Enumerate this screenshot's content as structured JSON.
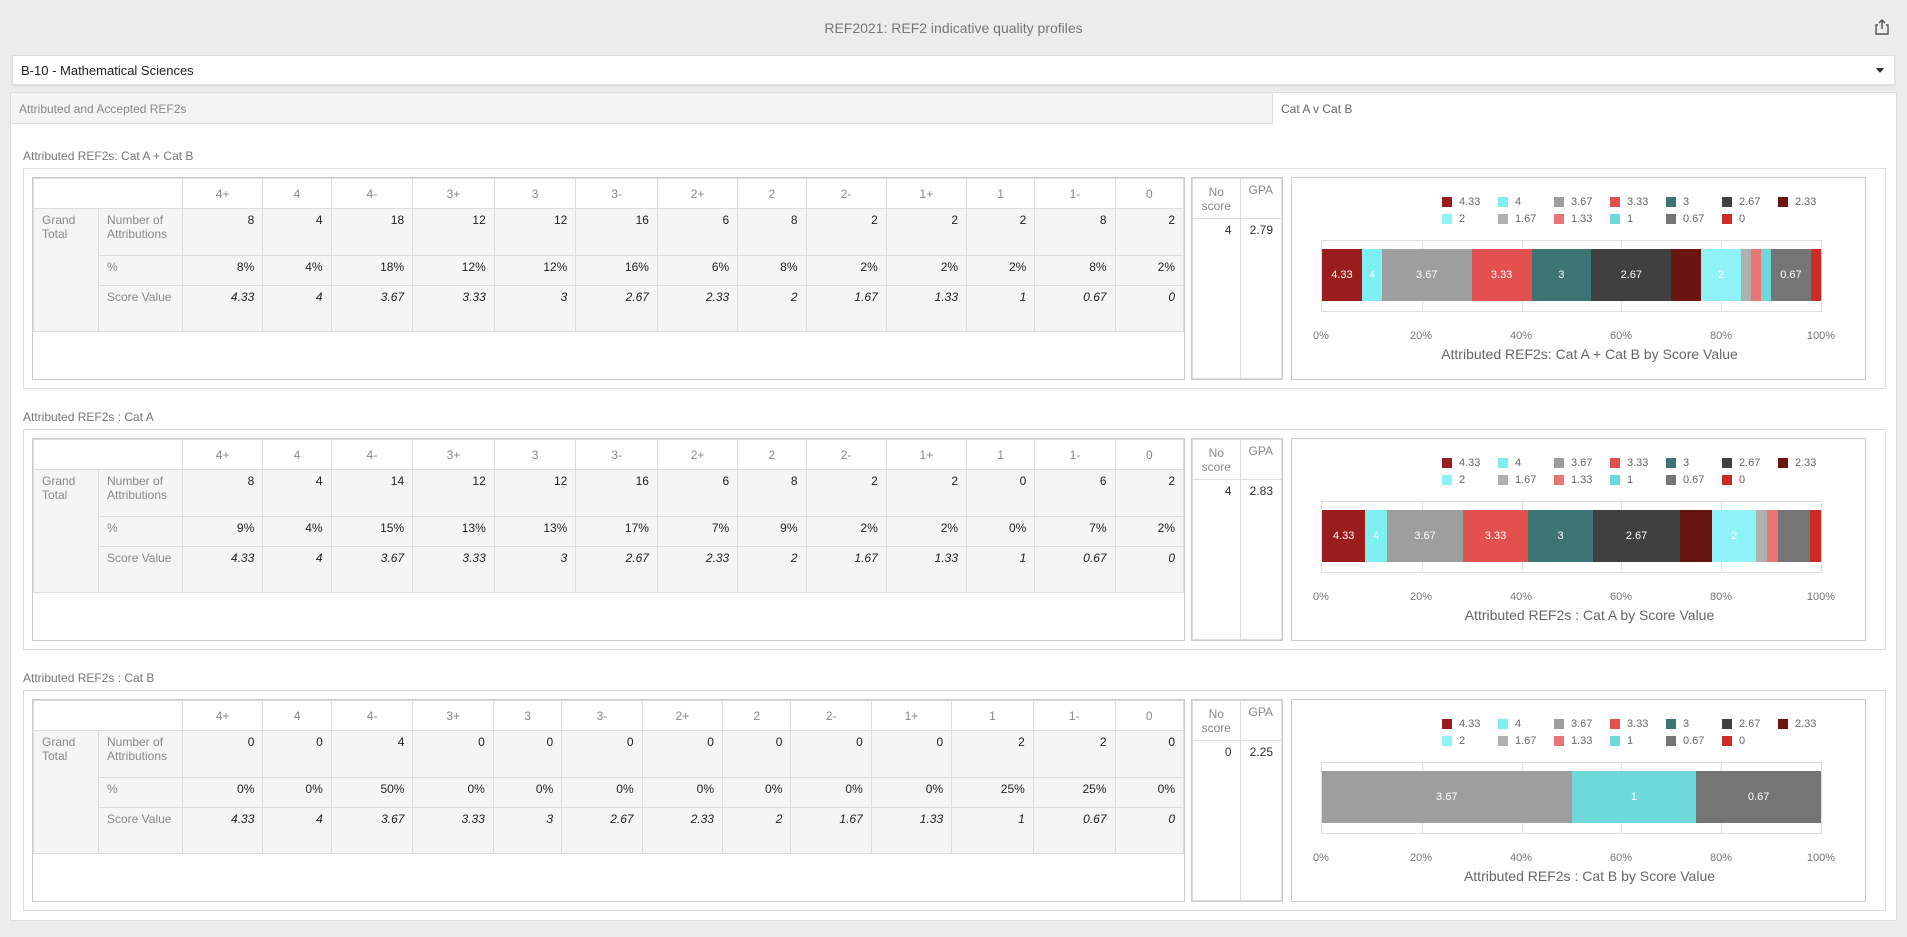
{
  "header": {
    "title": "REF2021: REF2 indicative quality profiles"
  },
  "unit_select": {
    "value": "B-10 - Mathematical Sciences"
  },
  "tabs": [
    {
      "label": "Attributed and Accepted REF2s"
    },
    {
      "label": "Cat A v Cat B"
    }
  ],
  "grades": [
    "4+",
    "4",
    "4-",
    "3+",
    "3",
    "3-",
    "2+",
    "2",
    "2-",
    "1+",
    "1",
    "1-",
    "0"
  ],
  "scores": [
    "4.33",
    "4",
    "3.67",
    "3.33",
    "3",
    "2.67",
    "2.33",
    "2",
    "1.67",
    "1.33",
    "1",
    "0.67",
    "0"
  ],
  "row_labels": {
    "group": "Grand Total",
    "count": "Number of Attributions",
    "pct": "%",
    "score": "Score Value"
  },
  "side_headers": {
    "no_score": "No score",
    "gpa": "GPA"
  },
  "colors": {
    "4.33": "#9b1c1c",
    "4": "#7ff0f2",
    "3.67": "#9e9e9e",
    "3.33": "#e2504f",
    "3": "#3d7575",
    "2.67": "#404040",
    "2.33": "#6b1510",
    "2": "#8ef2f7",
    "1.67": "#b0b0b0",
    "1.33": "#e87676",
    "1": "#6fd8da",
    "0.67": "#757575",
    "0": "#cc2b26"
  },
  "sections": [
    {
      "title": "Attributed REF2s: Cat A + Cat B",
      "counts": [
        "8",
        "4",
        "18",
        "12",
        "12",
        "16",
        "6",
        "8",
        "2",
        "2",
        "2",
        "8",
        "2"
      ],
      "percents": [
        "8%",
        "4%",
        "18%",
        "12%",
        "12%",
        "16%",
        "6%",
        "8%",
        "2%",
        "2%",
        "2%",
        "8%",
        "2%"
      ],
      "no_score": "4",
      "gpa": "2.79"
    },
    {
      "title": "Attributed REF2s : Cat A",
      "counts": [
        "8",
        "4",
        "14",
        "12",
        "12",
        "16",
        "6",
        "8",
        "2",
        "2",
        "0",
        "6",
        "2"
      ],
      "percents": [
        "9%",
        "4%",
        "15%",
        "13%",
        "13%",
        "17%",
        "7%",
        "9%",
        "2%",
        "2%",
        "0%",
        "7%",
        "2%"
      ],
      "no_score": "4",
      "gpa": "2.83"
    },
    {
      "title": "Attributed REF2s : Cat B",
      "counts": [
        "0",
        "0",
        "4",
        "0",
        "0",
        "0",
        "0",
        "0",
        "0",
        "0",
        "2",
        "2",
        "0"
      ],
      "percents": [
        "0%",
        "0%",
        "50%",
        "0%",
        "0%",
        "0%",
        "0%",
        "0%",
        "0%",
        "0%",
        "25%",
        "25%",
        "0%"
      ],
      "no_score": "0",
      "gpa": "2.25"
    }
  ],
  "chart_data": [
    {
      "type": "bar",
      "stacked": true,
      "orientation": "horizontal",
      "normalized": true,
      "title": "Attributed REF2s: Cat A + Cat B by Score Value",
      "categories": [
        "4.33",
        "4",
        "3.67",
        "3.33",
        "3",
        "2.67",
        "2.33",
        "2",
        "1.67",
        "1.33",
        "1",
        "0.67",
        "0"
      ],
      "values": [
        8,
        4,
        18,
        12,
        12,
        16,
        6,
        8,
        2,
        2,
        2,
        8,
        2
      ],
      "xlim": [
        0,
        100
      ],
      "xticks": [
        "0%",
        "20%",
        "40%",
        "60%",
        "80%",
        "100%"
      ],
      "legend": "top"
    },
    {
      "type": "bar",
      "stacked": true,
      "orientation": "horizontal",
      "normalized": true,
      "title": "Attributed REF2s : Cat A by Score Value",
      "categories": [
        "4.33",
        "4",
        "3.67",
        "3.33",
        "3",
        "2.67",
        "2.33",
        "2",
        "1.67",
        "1.33",
        "1",
        "0.67",
        "0"
      ],
      "values": [
        8,
        4,
        14,
        12,
        12,
        16,
        6,
        8,
        2,
        2,
        0,
        6,
        2
      ],
      "xlim": [
        0,
        100
      ],
      "xticks": [
        "0%",
        "20%",
        "40%",
        "60%",
        "80%",
        "100%"
      ],
      "legend": "top"
    },
    {
      "type": "bar",
      "stacked": true,
      "orientation": "horizontal",
      "normalized": true,
      "title": "Attributed REF2s : Cat B by Score Value",
      "categories": [
        "4.33",
        "4",
        "3.67",
        "3.33",
        "3",
        "2.67",
        "2.33",
        "2",
        "1.67",
        "1.33",
        "1",
        "0.67",
        "0"
      ],
      "values": [
        0,
        0,
        4,
        0,
        0,
        0,
        0,
        0,
        0,
        0,
        2,
        2,
        0
      ],
      "xlim": [
        0,
        100
      ],
      "xticks": [
        "0%",
        "20%",
        "40%",
        "60%",
        "80%",
        "100%"
      ],
      "legend": "top"
    }
  ]
}
